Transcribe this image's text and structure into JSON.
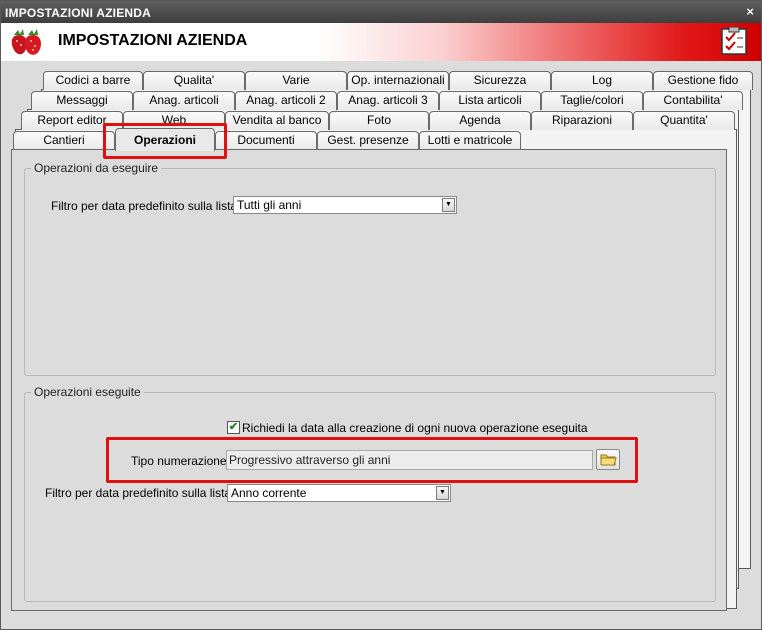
{
  "window": {
    "title": "IMPOSTAZIONI AZIENDA",
    "close_glyph": "×"
  },
  "header": {
    "title": "IMPOSTAZIONI AZIENDA",
    "logo_icon": "strawberry-icon",
    "checklist_icon": "checklist-icon"
  },
  "tabs": {
    "row1": [
      "Codici a barre",
      "Qualita'",
      "Varie",
      "Op. internazionali",
      "Sicurezza",
      "Log",
      "Gestione fido"
    ],
    "row2": [
      "Messaggi",
      "Anag. articoli",
      "Anag. articoli 2",
      "Anag. articoli 3",
      "Lista articoli",
      "Taglie/colori",
      "Contabilita'"
    ],
    "row3": [
      "Report editor",
      "Web",
      "Vendita al banco",
      "Foto",
      "Agenda",
      "Riparazioni",
      "Quantita'"
    ],
    "row4": [
      "Cantieri",
      "Operazioni",
      "Documenti",
      "Gest. presenze",
      "Lotti e matricole"
    ],
    "active": "Operazioni"
  },
  "group1": {
    "title": "Operazioni da eseguire",
    "filter_label": "Filtro per data predefinito sulla lista :",
    "filter_value": "Tutti gli anni"
  },
  "group2": {
    "title": "Operazioni eseguite",
    "checkbox_label": "Richiedi la data alla creazione di ogni nuova operazione eseguita",
    "checkbox_checked": true,
    "checkbox_mark": "✔",
    "tipo_label": "Tipo numerazione :",
    "tipo_value": "Progressivo attraverso gli anni",
    "tipo_button_icon": "folder-icon",
    "filter_label": "Filtro per data predefinito sulla lista :",
    "filter_value": "Anno corrente"
  },
  "colors": {
    "highlight": "#e01010",
    "header_red": "#d00000",
    "check_green": "#1b8a1b"
  }
}
